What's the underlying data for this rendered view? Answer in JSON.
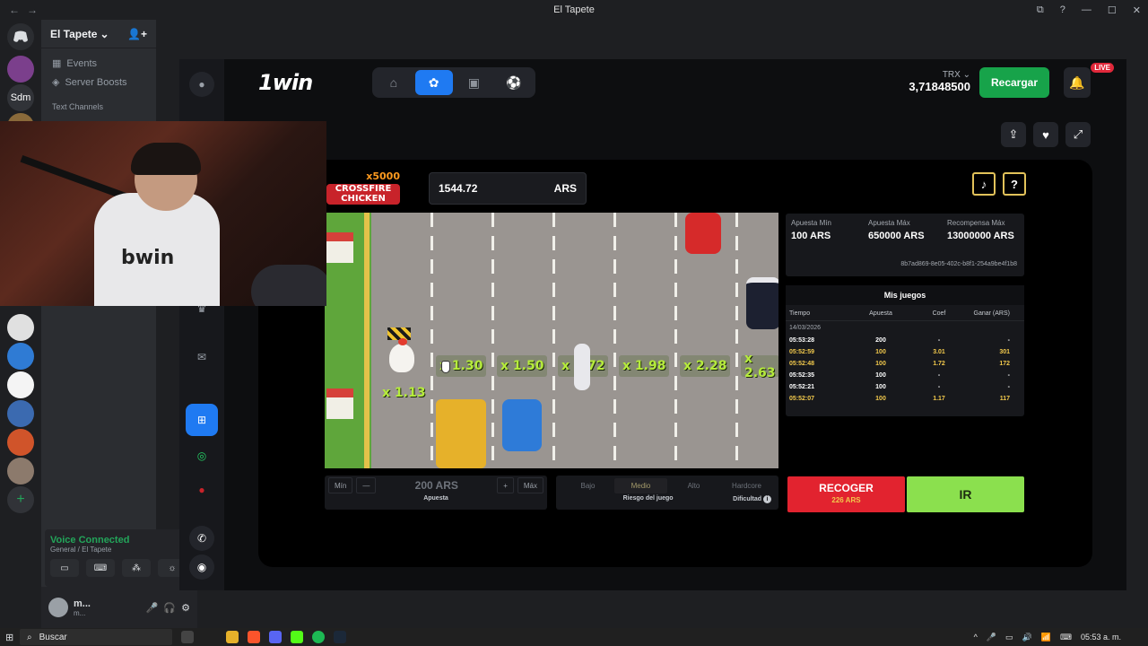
{
  "titlebar": {
    "title": "El Tapete",
    "back": "←",
    "forward": "→",
    "inbox": "⧉",
    "help": "?",
    "minimize": "—",
    "maximize": "☐",
    "close": "✕"
  },
  "discord": {
    "server_name": "El Tapete",
    "server_caret": "⌄",
    "invite_icon": "👤+",
    "channels": [
      {
        "icon": "▦",
        "label": "Events"
      },
      {
        "icon": "◈",
        "label": "Server Boosts"
      }
    ],
    "text_channels_label": "Text Channels",
    "guild_sdm": "Sdm",
    "voice": {
      "status": "Voice Connected",
      "channel": "General / El Tapete"
    },
    "voice_buttons": [
      "▭",
      "⌨",
      "⁂",
      "☼"
    ],
    "user": {
      "name": "m...",
      "sub": "m...",
      "mic": "🎤",
      "headset": "🎧",
      "settings": "⚙"
    }
  },
  "site": {
    "logo": "1win",
    "nav": [
      {
        "name": "home",
        "glyph": "⌂",
        "active": false
      },
      {
        "name": "casino",
        "glyph": "✿",
        "active": true
      },
      {
        "name": "live-casino",
        "glyph": "▣",
        "active": false
      },
      {
        "name": "sports",
        "glyph": "⚽",
        "active": false
      }
    ],
    "currency": "TRX ⌄",
    "balance": "3,71848500",
    "recargar": "Recargar",
    "bell": "🔔",
    "live": "LIVE",
    "tools": {
      "share": "⇪",
      "favorite": "♥",
      "fullscreen": "⤢"
    },
    "leftbar": {
      "profile": "●",
      "crown": "♛",
      "support": "✉",
      "phone": "✆",
      "chat": "◉",
      "flag": "●"
    }
  },
  "game": {
    "logo_top": "x5000",
    "logo_name": "CROSSFIRE CHICKEN",
    "balance_value": "1544.72",
    "balance_currency": "ARS",
    "sound_glyph": "♪",
    "help_glyph": "?",
    "multipliers": [
      "x 1.30",
      "x 1.50",
      "x 1.72",
      "x 1.98",
      "x 2.28",
      "x 2.63"
    ],
    "current_multiplier": "x 1.13",
    "info": {
      "min_label": "Apuesta Mín",
      "min_value": "100 ARS",
      "max_label": "Apuesta Máx",
      "max_value": "650000 ARS",
      "reward_label": "Recompensa Máx",
      "reward_value": "13000000 ARS",
      "hash": "8b7ad869-8e05-402c-b8f1-254a9be4f1b8"
    },
    "mis_juegos": {
      "title": "Mis juegos",
      "headers": [
        "Tiempo",
        "Apuesta",
        "Coef",
        "Ganar (ARS)"
      ],
      "date": "14/03/2026",
      "rows": [
        {
          "time": "05:53:28",
          "bet": "200",
          "coef": "-",
          "win": "-",
          "win_color": "#ffffff"
        },
        {
          "time": "05:52:59",
          "bet": "100",
          "coef": "3.01",
          "win": "301",
          "win_color": "#f2c94c"
        },
        {
          "time": "05:52:48",
          "bet": "100",
          "coef": "1.72",
          "win": "172",
          "win_color": "#f2c94c"
        },
        {
          "time": "05:52:35",
          "bet": "100",
          "coef": "-",
          "win": "-",
          "win_color": "#ffffff"
        },
        {
          "time": "05:52:21",
          "bet": "100",
          "coef": "-",
          "win": "-",
          "win_color": "#ffffff"
        },
        {
          "time": "05:52:07",
          "bet": "100",
          "coef": "1.17",
          "win": "117",
          "win_color": "#f2c94c"
        }
      ]
    },
    "bet": {
      "min": "Mín",
      "minus": "—",
      "value": "200 ARS",
      "plus": "+",
      "max": "Máx",
      "label": "Apuesta"
    },
    "risk": {
      "options": [
        "Bajo",
        "Medio",
        "Alto",
        "Hardcore"
      ],
      "selected": "Medio",
      "label": "Riesgo del juego",
      "difficulty": "Dificultad",
      "info_glyph": "i"
    },
    "recoger": {
      "label": "RECOGER",
      "amount": "226 ARS"
    },
    "ir": "IR"
  },
  "webcam": {
    "shirt_text": "bwin"
  },
  "taskbar": {
    "start": "⊞",
    "search": "Buscar",
    "search_icon": "⌕",
    "time": "05:53 a. m.",
    "tray": [
      "^",
      "🎤",
      "▭",
      "🔊",
      "📶",
      "⌨"
    ]
  }
}
